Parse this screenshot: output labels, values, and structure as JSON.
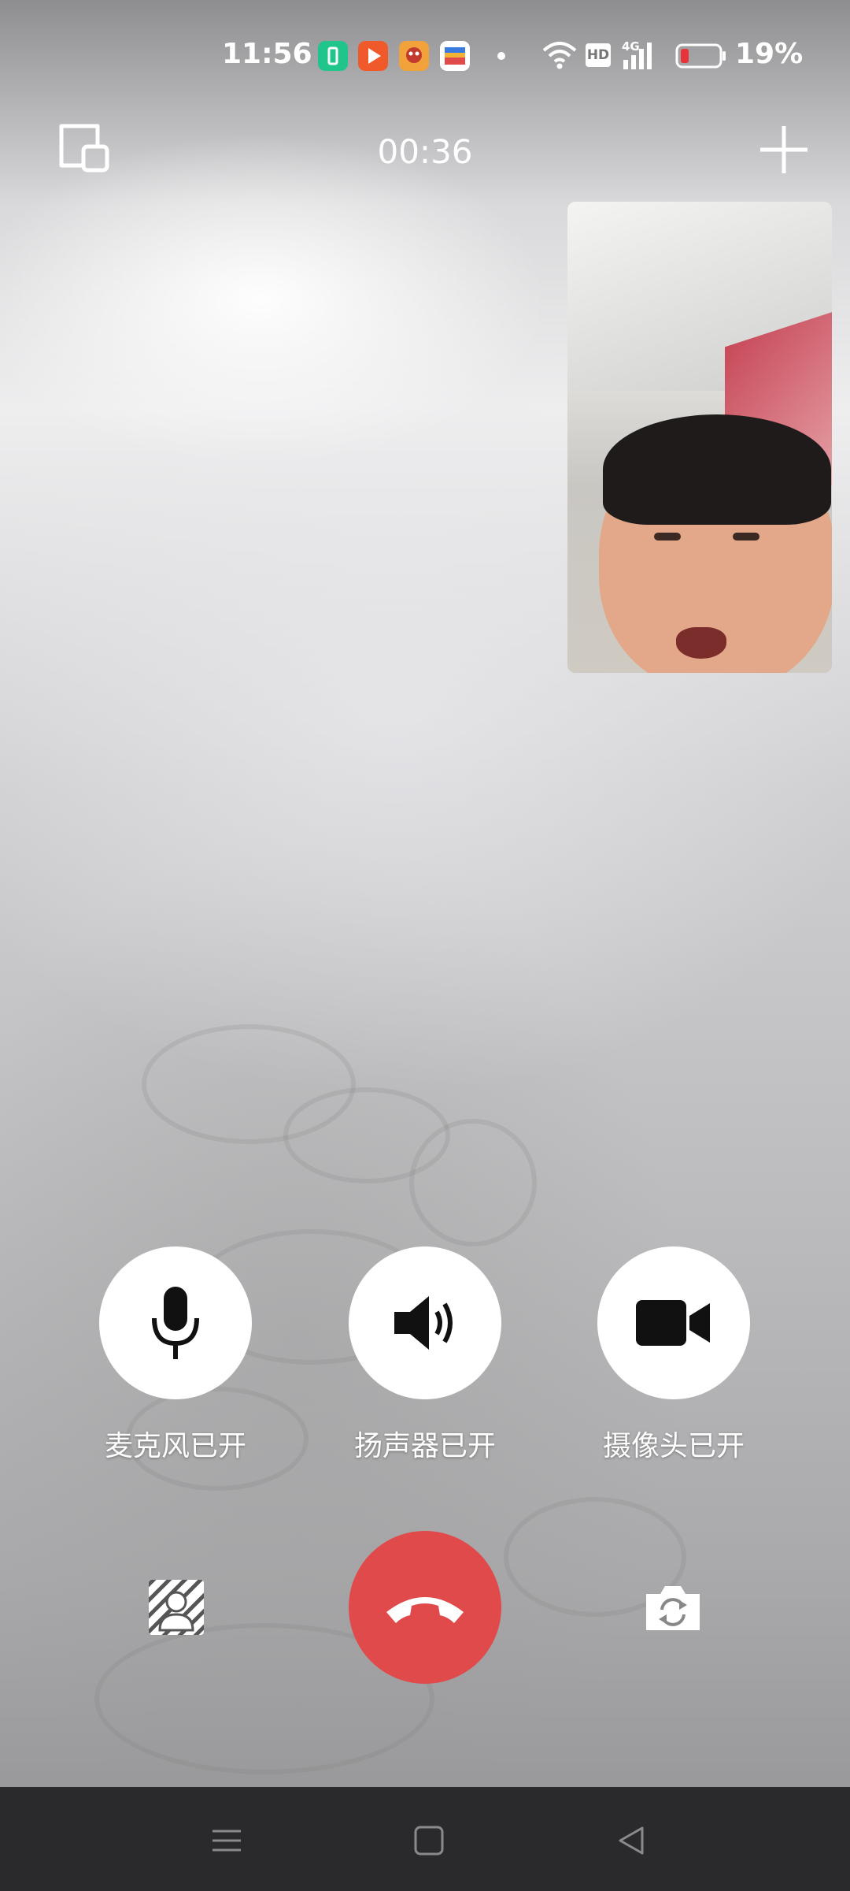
{
  "status_bar": {
    "time": "11:56",
    "battery_percent": "19%",
    "battery_level": 0.19,
    "hd_badge": "HD",
    "network_badge": "4G",
    "icons": [
      "battery-saver-app-icon",
      "video-app-icon",
      "game-app-icon",
      "wallet-app-icon",
      "wifi-icon",
      "signal-icon",
      "battery-icon"
    ]
  },
  "call": {
    "timer": "00:36"
  },
  "controls": {
    "mic_label": "麦克风已开",
    "speaker_label": "扬声器已开",
    "camera_label": "摄像头已开"
  },
  "colors": {
    "hangup": "#e04a4b",
    "control_bg": "#ffffff",
    "navbar": "#2a2a2c"
  },
  "navigation": {
    "icons": [
      "menu-icon",
      "home-icon",
      "back-icon"
    ]
  }
}
